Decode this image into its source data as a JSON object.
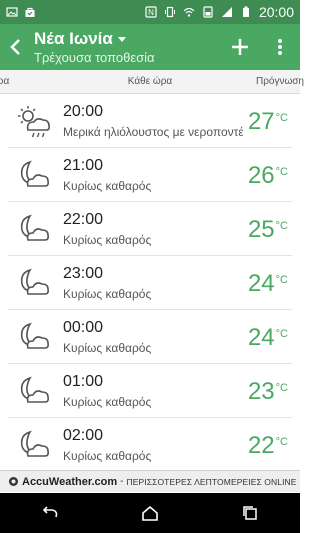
{
  "status_bar": {
    "time": "20:00",
    "icons_left": [
      "image-icon",
      "bag-icon"
    ],
    "icons_right": [
      "nfc-icon",
      "vibrate-icon",
      "wifi-icon",
      "battery-saver-icon",
      "signal-icon",
      "battery-icon"
    ]
  },
  "app_bar": {
    "title": "Νέα Ιωνία",
    "subtitle": "Τρέχουσα τοποθεσία",
    "add_icon": "plus-icon",
    "more_icon": "more-vert-icon"
  },
  "tabs": {
    "left": "ώρα",
    "center": "Κάθε ώρα",
    "right": "Πρόγνωση"
  },
  "hourly": [
    {
      "time": "20:00",
      "desc": "Μερικά ηλιόλουστος με νεροποντές",
      "temp": "27",
      "unit": "°C",
      "icon": "partly-sunny-showers-icon"
    },
    {
      "time": "21:00",
      "desc": "Κυρίως καθαρός",
      "temp": "26",
      "unit": "°C",
      "icon": "moon-cloud-icon"
    },
    {
      "time": "22:00",
      "desc": "Κυρίως καθαρός",
      "temp": "25",
      "unit": "°C",
      "icon": "moon-cloud-icon"
    },
    {
      "time": "23:00",
      "desc": "Κυρίως καθαρός",
      "temp": "24",
      "unit": "°C",
      "icon": "moon-cloud-icon"
    },
    {
      "time": "00:00",
      "desc": "Κυρίως καθαρός",
      "temp": "24",
      "unit": "°C",
      "icon": "moon-cloud-icon"
    },
    {
      "time": "01:00",
      "desc": "Κυρίως καθαρός",
      "temp": "23",
      "unit": "°C",
      "icon": "moon-cloud-icon"
    },
    {
      "time": "02:00",
      "desc": "Κυρίως καθαρός",
      "temp": "22",
      "unit": "°C",
      "icon": "moon-cloud-icon"
    }
  ],
  "footer": {
    "brand": "AccuWeather.com",
    "separator": "-",
    "tagline": "ΠΕΡΙΣΣΟΤΕΡΕΣ ΛΕΠΤΟΜΕΡΕΙΕΣ ONLINE"
  },
  "colors": {
    "status_bar": "#3f8c52",
    "app_bar": "#4aa862",
    "temperature": "#4aa862"
  }
}
